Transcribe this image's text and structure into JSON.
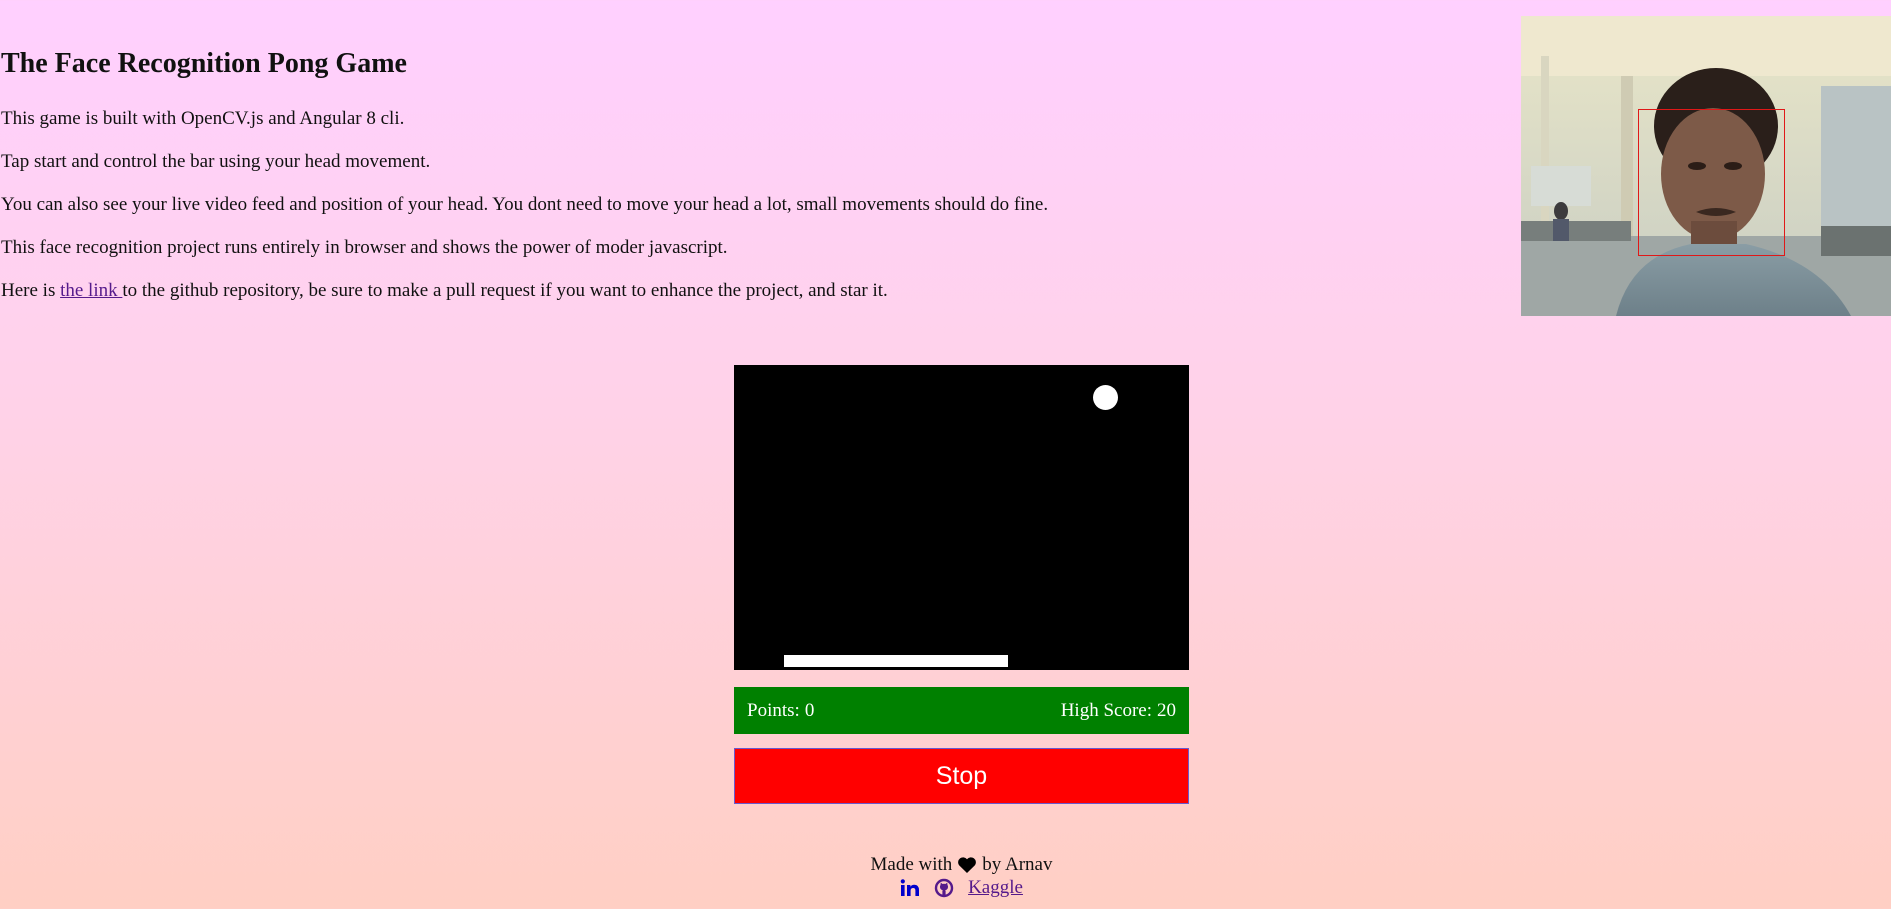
{
  "intro": {
    "title": "The Face Recognition Pong Game",
    "line1": "This game is built with OpenCV.js and Angular 8 cli.",
    "line2": "Tap start and control the bar using your head movement.",
    "line3": "You can also see your live video feed and position of your head. You dont need to move your head a lot, small movements should do fine.",
    "line4": "This face recognition project runs entirely in browser and shows the power of moder javascript.",
    "line5_before": "Here is ",
    "line5_link": "the link ",
    "line5_after": "to the github repository, be sure to make a pull request if you want to enhance the project, and star it."
  },
  "score": {
    "points_label": "Points:",
    "points": "0",
    "high_label": "High Score:",
    "high": "20"
  },
  "controls": {
    "stop_label": "Stop"
  },
  "footer": {
    "made_with": "Made with",
    "by": "by Arnav",
    "kaggle": "Kaggle"
  },
  "colors": {
    "score_bar": "#008000",
    "stop_button": "#ff0000",
    "link": "#551a8b",
    "face_box": "#e01818"
  },
  "icons": [
    "heart-icon",
    "linkedin-icon",
    "github-icon"
  ]
}
